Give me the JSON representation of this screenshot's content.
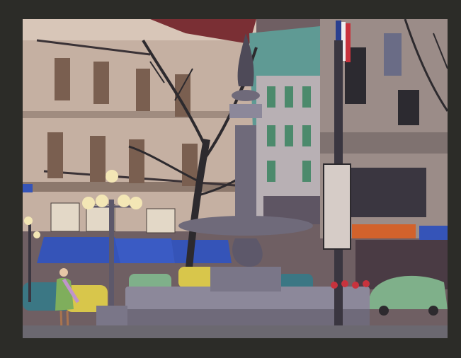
{
  "image": {
    "background": "#2c2c28",
    "subject": "illustration-street-square-fountain",
    "palette": {
      "sky": "#6f5f63",
      "building_left": "#c5b0a2",
      "building_left_shadow": "#a08c80",
      "shutters": "#7a5f50",
      "building_mid": "#5f9a94",
      "building_right": "#9b8c88",
      "awning": "#3554b8",
      "awning_right": "#d2622c",
      "fountain": "#6f6a7a",
      "fountain_light": "#8c889a",
      "tree": "#2d2a2e",
      "lamp_glow": "#f3e6b5",
      "car_yellow": "#d8c64b",
      "car_green": "#7fb08a",
      "car_teal": "#3b7784",
      "dress": "#7fae5c",
      "flag_blue": "#2a3f8f",
      "flag_red": "#c8333d",
      "ground": "#6b6870"
    }
  }
}
